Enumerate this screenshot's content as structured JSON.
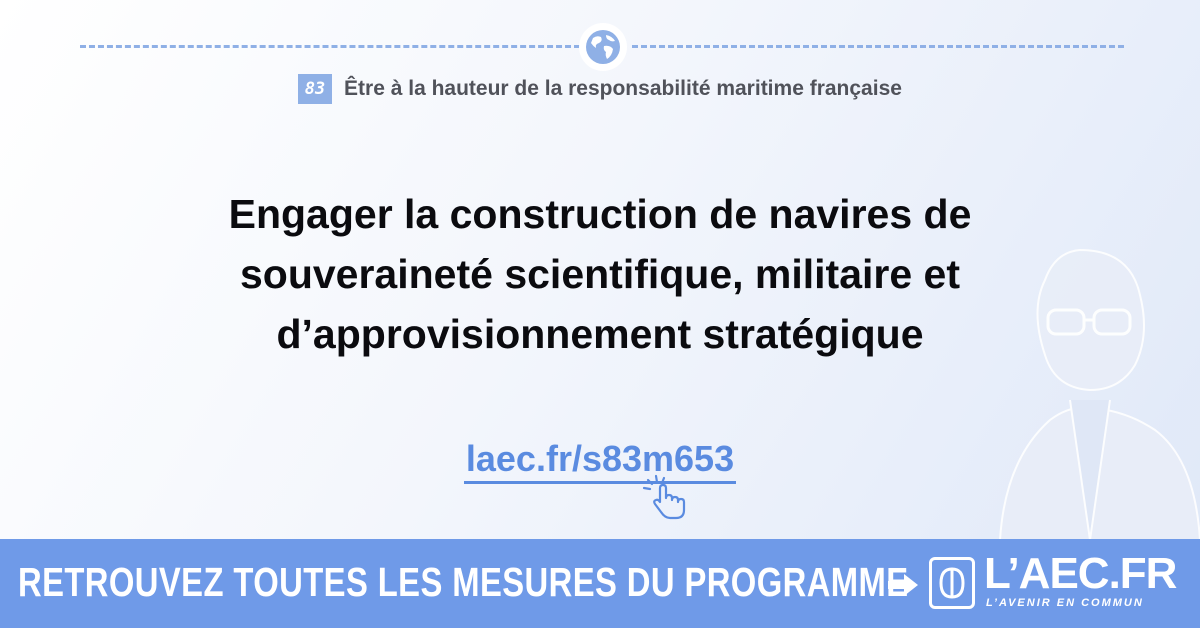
{
  "chapter": {
    "number": "83",
    "title": "Être à la hauteur de la responsabilité maritime française",
    "icon": "globe-icon"
  },
  "headline": {
    "line1": "Engager la construction de navires de",
    "line2": "souveraineté scientifique, militaire et",
    "line3": "d’approvisionnement stratégique"
  },
  "link": {
    "text": "laec.fr/s83m653",
    "icon": "pointer-hand-icon"
  },
  "banner": {
    "cta": "RETROUVEZ TOUTES LES MESURES DU PROGRAMME",
    "arrow_icon": "arrow-right-icon",
    "logo_text": "L’AEC.FR",
    "logo_tagline": "L’AVENIR EN COMMUN"
  },
  "colors": {
    "accent": "#6f9ae8",
    "link": "#5a8be0",
    "dash": "#8fb0e6",
    "headline": "#0b0b0f"
  }
}
